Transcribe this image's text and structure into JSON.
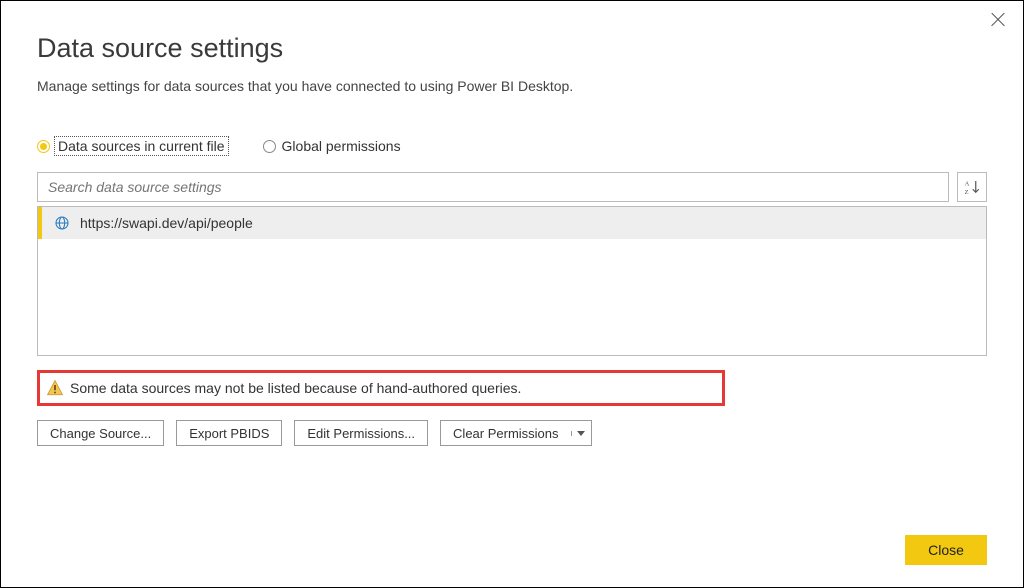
{
  "dialog": {
    "title": "Data source settings",
    "subtitle": "Manage settings for data sources that you have connected to using Power BI Desktop."
  },
  "radios": {
    "current_file": "Data sources in current file",
    "global": "Global permissions"
  },
  "search": {
    "placeholder": "Search data source settings"
  },
  "sources": {
    "item0": "https://swapi.dev/api/people"
  },
  "warning": {
    "text": "Some data sources may not be listed because of hand-authored queries."
  },
  "buttons": {
    "change_source": "Change Source...",
    "export_pbids": "Export PBIDS",
    "edit_permissions": "Edit Permissions...",
    "clear_permissions": "Clear Permissions",
    "close": "Close"
  }
}
